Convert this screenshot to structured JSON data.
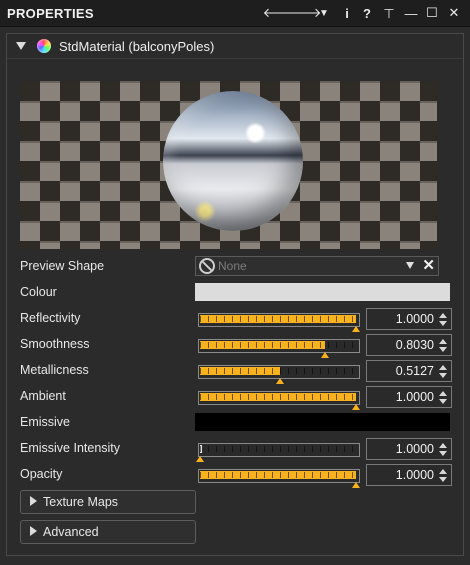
{
  "titlebar": {
    "title": "PROPERTIES",
    "buttons": [
      "back",
      "forward",
      "menu",
      "info",
      "help",
      "pin",
      "minimize",
      "maximize",
      "close"
    ],
    "glyphs": [
      "🡐",
      "🡒",
      "▼",
      "i",
      "?",
      "⊥",
      "—",
      "☐",
      "✕"
    ]
  },
  "material": {
    "name": "StdMaterial (balconyPoles)"
  },
  "properties": {
    "preview_shape": {
      "label": "Preview Shape",
      "value": "None"
    },
    "colour": {
      "label": "Colour",
      "color": "#dcdcdc"
    },
    "reflectivity": {
      "label": "Reflectivity",
      "value": "1.0000",
      "level": 1.0
    },
    "smoothness": {
      "label": "Smoothness",
      "value": "0.8030",
      "level": 0.803
    },
    "metallicness": {
      "label": "Metallicness",
      "value": "0.5127",
      "level": 0.5127
    },
    "ambient": {
      "label": "Ambient",
      "value": "1.0000",
      "level": 1.0
    },
    "emissive": {
      "label": "Emissive",
      "color": "#000000"
    },
    "emissive_intensity": {
      "label": "Emissive Intensity",
      "value": "1.0000",
      "level": 0.0
    },
    "opacity": {
      "label": "Opacity",
      "value": "1.0000",
      "level": 1.0
    }
  },
  "sections": {
    "texture_maps": "Texture Maps",
    "advanced": "Advanced"
  },
  "colors": {
    "accent": "#f7b21e",
    "background": "#2b2b2b"
  }
}
